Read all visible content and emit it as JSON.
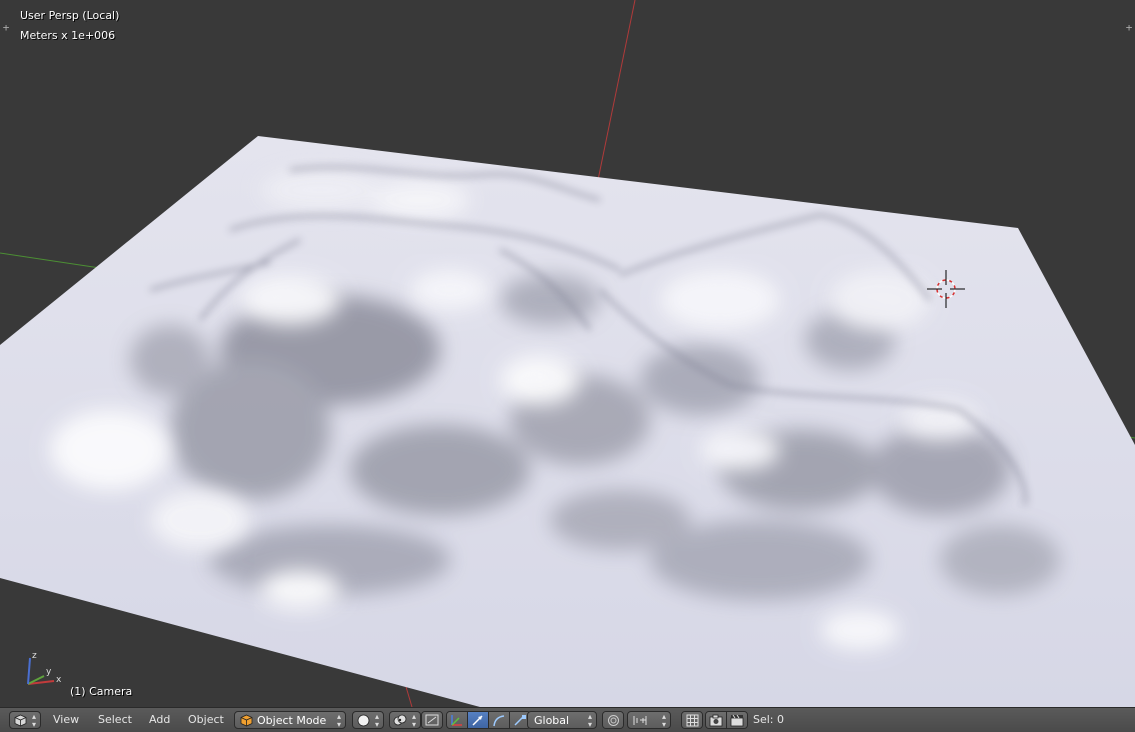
{
  "viewport": {
    "view_name": "User Persp (Local)",
    "units": "Meters x 1e+006",
    "object_label": "(1) Camera"
  },
  "header": {
    "menus": [
      "View",
      "Select",
      "Add",
      "Object"
    ],
    "mode": "Object Mode",
    "transform_orientation": "Global",
    "selection_status": "Sel: 0"
  },
  "colors": {
    "background": "#393939",
    "terrain_base": "#d8d9e6",
    "terrain_shadow": "#8e8f9c",
    "axis_x": "#c0392b",
    "axis_y": "#5fa33c",
    "header_bg": "#4d4d4d",
    "active_button": "#5680c2"
  }
}
